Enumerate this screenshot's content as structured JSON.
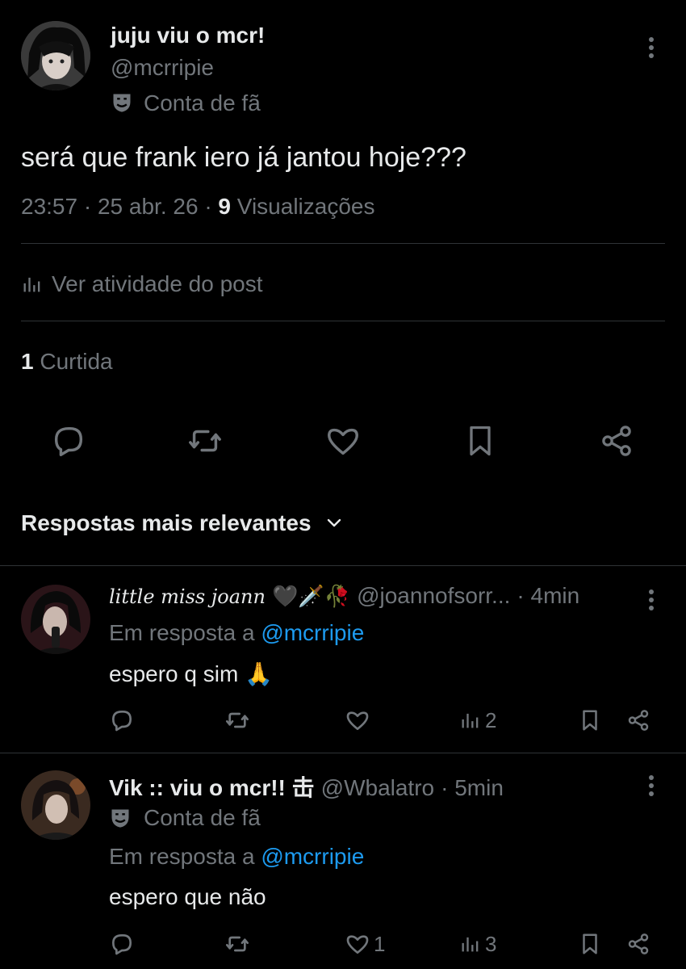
{
  "post": {
    "display_name": "juju viu o mcr!",
    "handle": "@mcrripie",
    "badge": "Conta de fã",
    "text": "será que frank iero já jantou hoje???",
    "time": "23:57",
    "date": "25 abr. 26",
    "views_count": "9",
    "views_label": "Visualizações",
    "activity_label": "Ver atividade do post",
    "likes_count": "1",
    "likes_label": "Curtida"
  },
  "sort": {
    "label": "Respostas mais relevantes"
  },
  "replies": [
    {
      "display_name": "little miss joann",
      "emojis": "🖤🗡️🥀",
      "handle": "@joannofsorr...",
      "time": "· 4min",
      "in_reply_prefix": "Em resposta a",
      "in_reply_handle": "@mcrripie",
      "text": "espero q sim 🙏",
      "likes": "",
      "views": "2"
    },
    {
      "display_name": "Vik :: viu o mcr!! 击",
      "handle": "@Wbalatro",
      "time": "· 5min",
      "badge": "Conta de fã",
      "in_reply_prefix": "Em resposta a",
      "in_reply_handle": "@mcrripie",
      "text": "espero que não",
      "likes": "1",
      "views": "3"
    }
  ],
  "icons": [
    "more-icon",
    "mask-icon",
    "chart-icon",
    "reply-icon",
    "retweet-icon",
    "like-icon",
    "bookmark-icon",
    "share-icon",
    "chevron-down-icon"
  ],
  "colors": {
    "background": "#000000",
    "text": "#e7e9ea",
    "muted": "#71767b",
    "link": "#1d9bf0",
    "divider": "#2f3336"
  }
}
